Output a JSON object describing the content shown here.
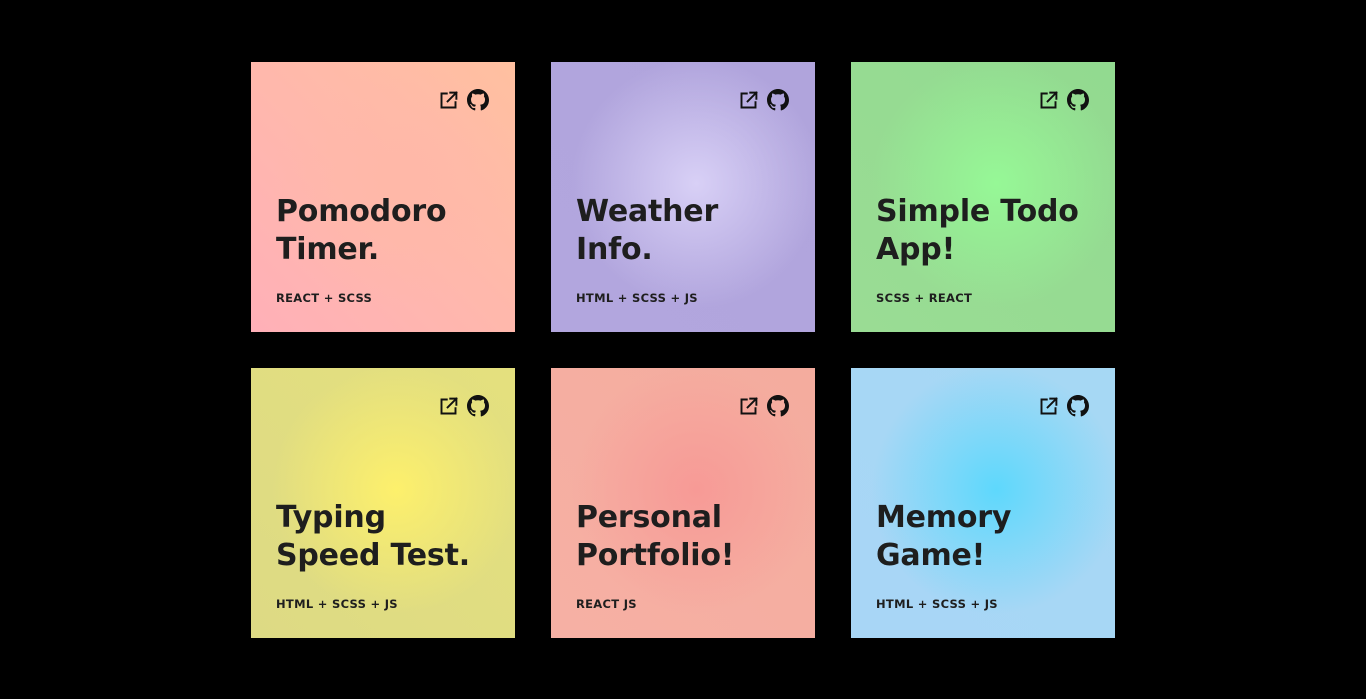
{
  "projects": [
    {
      "title_line1": "Pomodoro",
      "title_line2": "Timer.",
      "tags": "REACT + SCSS",
      "colors": {
        "center": "#ffb8a8",
        "edge_a": "#ffc0a0",
        "edge_b": "#ffb0b8"
      },
      "icons": [
        "external-link-icon",
        "github-icon"
      ]
    },
    {
      "title_line1": "Weather",
      "title_line2": "Info.",
      "tags": "HTML + SCSS + JS",
      "colors": {
        "center": "#d8d0f6",
        "edge_a": "#b0a4dc",
        "edge_b": "#b2a6de"
      },
      "icons": [
        "external-link-icon",
        "github-icon"
      ]
    },
    {
      "title_line1": "Simple Todo",
      "title_line2": "App!",
      "tags": "SCSS + REACT",
      "colors": {
        "center": "#96f896",
        "edge_a": "#92da90",
        "edge_b": "#9adc94"
      },
      "icons": [
        "external-link-icon",
        "github-icon"
      ]
    },
    {
      "title_line1": "Typing",
      "title_line2": "Speed Test.",
      "tags": "HTML + SCSS + JS",
      "colors": {
        "center": "#fdf06c",
        "edge_a": "#e4e07e",
        "edge_b": "#ddda84"
      },
      "icons": [
        "external-link-icon",
        "github-icon"
      ]
    },
    {
      "title_line1": "Personal",
      "title_line2": "Portfolio!",
      "tags": "REACT JS",
      "colors": {
        "center": "#f79a96",
        "edge_a": "#f4ac9e",
        "edge_b": "#f6b0a4"
      },
      "icons": [
        "external-link-icon",
        "github-icon"
      ]
    },
    {
      "title_line1": "Memory",
      "title_line2": "Game!",
      "tags": "HTML + SCSS + JS",
      "colors": {
        "center": "#5ed8fc",
        "edge_a": "#a6d8f4",
        "edge_b": "#a8d6f6"
      },
      "icons": [
        "external-link-icon",
        "github-icon"
      ]
    }
  ]
}
